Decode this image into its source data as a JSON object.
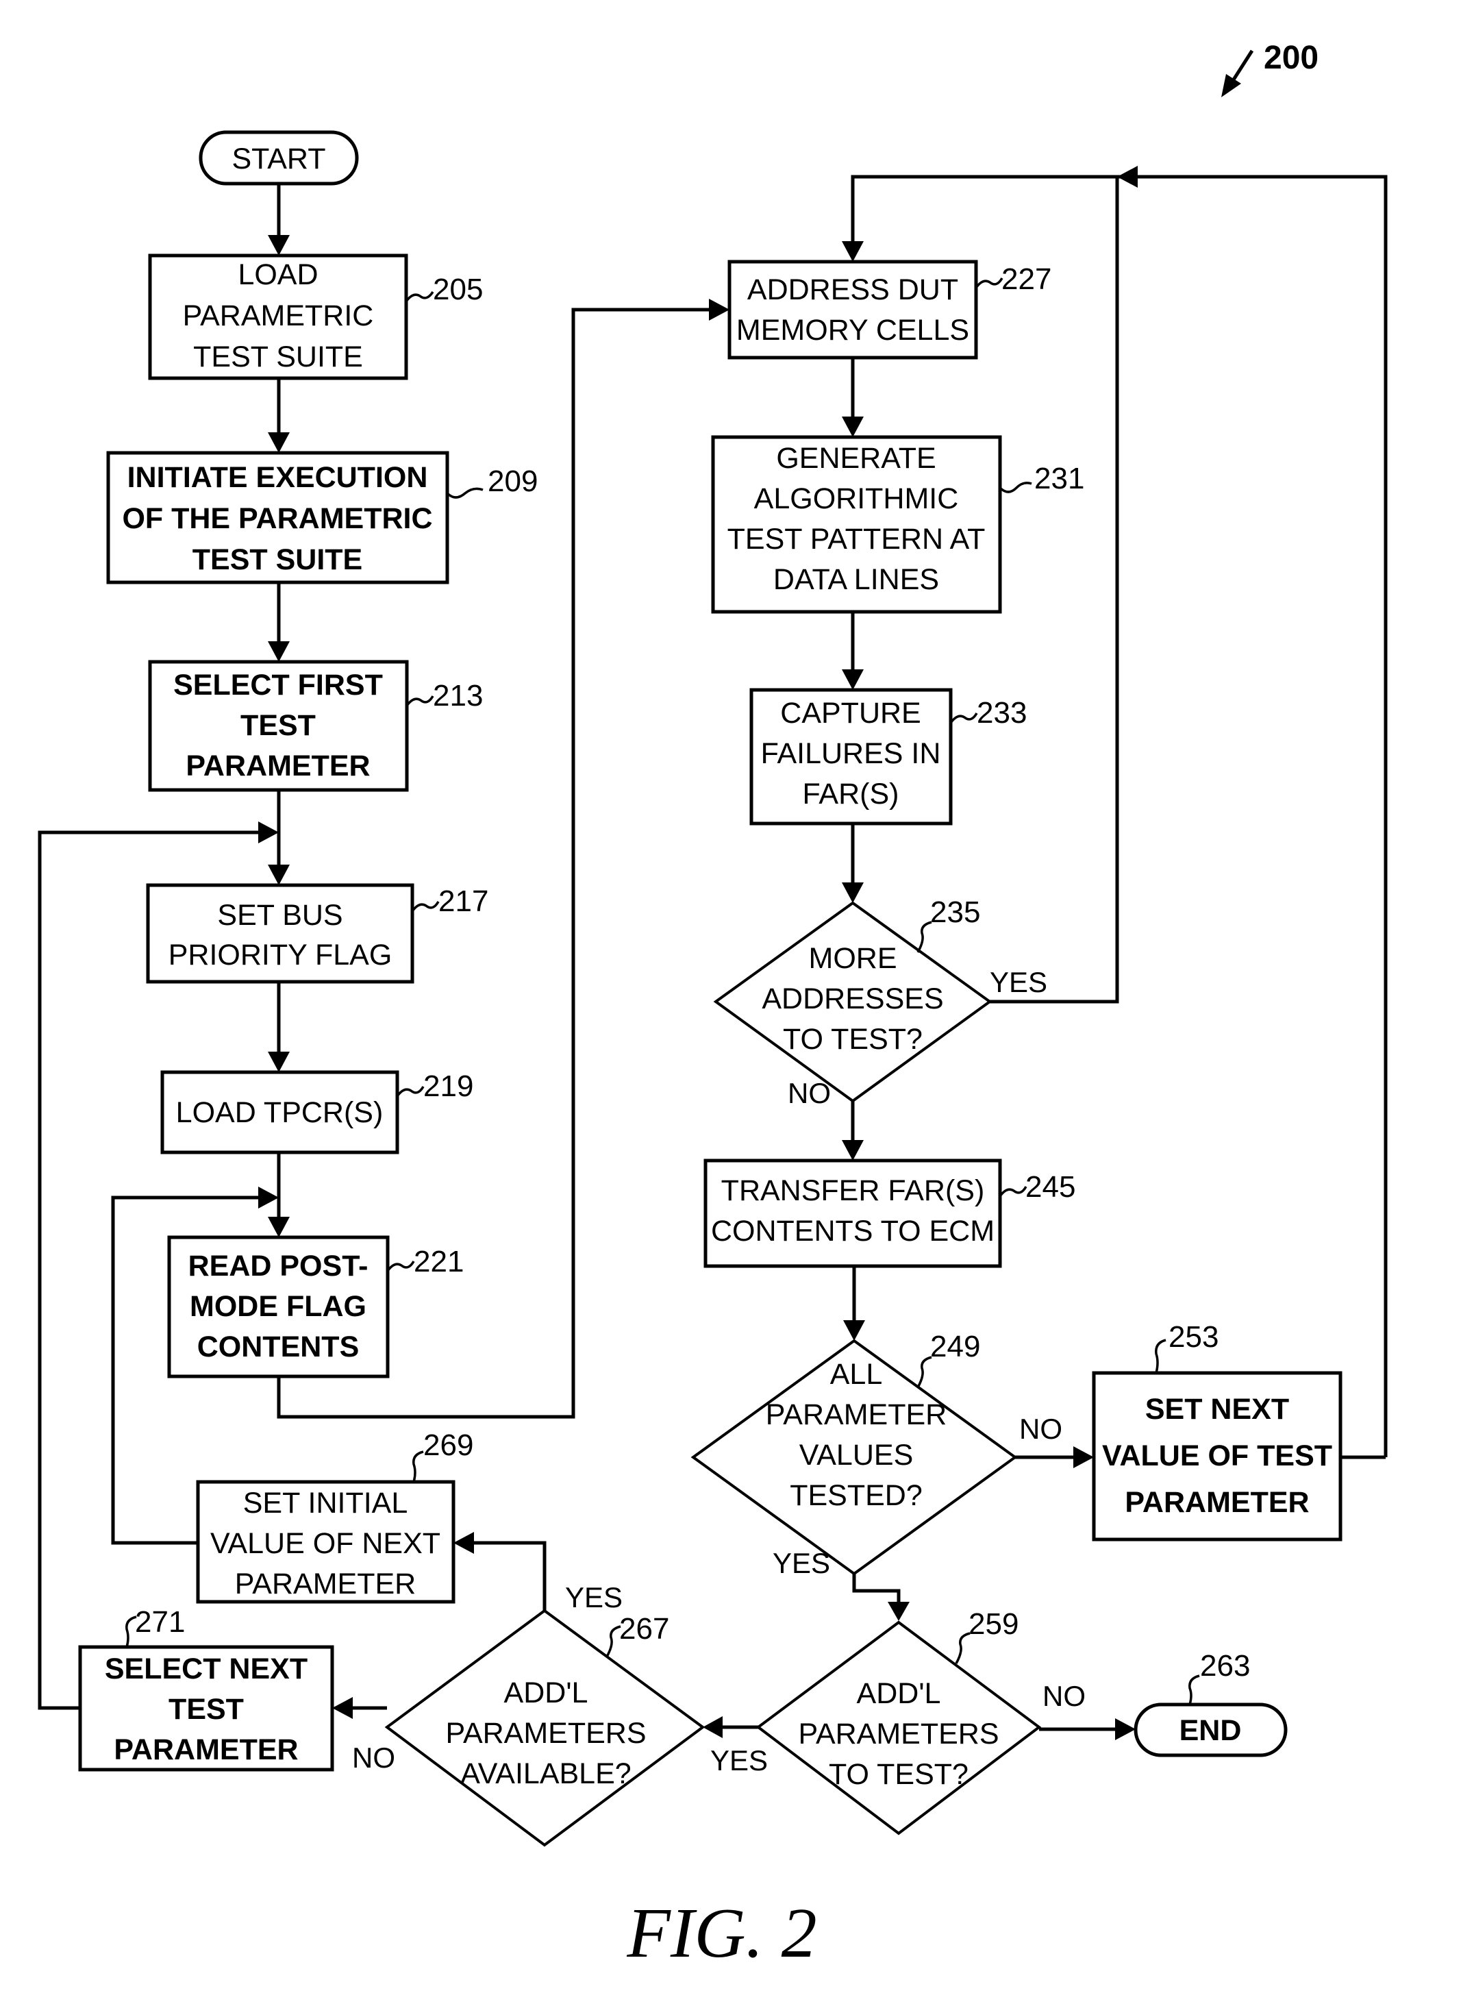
{
  "figure": {
    "caption": "FIG. 2",
    "ref_number": "200"
  },
  "nodes": {
    "start": {
      "type": "terminal",
      "lines": [
        "START"
      ]
    },
    "n205": {
      "ref": "205",
      "type": "process",
      "lines": [
        "LOAD",
        "PARAMETRIC",
        "TEST SUITE"
      ]
    },
    "n209": {
      "ref": "209",
      "type": "process",
      "lines": [
        "INITIATE EXECUTION",
        "OF THE PARAMETRIC",
        "TEST SUITE"
      ]
    },
    "n213": {
      "ref": "213",
      "type": "process",
      "lines": [
        "SELECT FIRST",
        "TEST",
        "PARAMETER"
      ]
    },
    "n217": {
      "ref": "217",
      "type": "process",
      "lines": [
        "SET BUS",
        "PRIORITY FLAG"
      ]
    },
    "n219": {
      "ref": "219",
      "type": "process",
      "lines": [
        "LOAD TPCR(S)"
      ]
    },
    "n221": {
      "ref": "221",
      "type": "process",
      "lines": [
        "READ POST-",
        "MODE FLAG",
        "CONTENTS"
      ]
    },
    "n227": {
      "ref": "227",
      "type": "process",
      "lines": [
        "ADDRESS DUT",
        "MEMORY CELLS"
      ]
    },
    "n231": {
      "ref": "231",
      "type": "process",
      "lines": [
        "GENERATE",
        "ALGORITHMIC",
        "TEST PATTERN AT",
        "DATA LINES"
      ]
    },
    "n233": {
      "ref": "233",
      "type": "process",
      "lines": [
        "CAPTURE",
        "FAILURES IN",
        "FAR(S)"
      ]
    },
    "n235": {
      "ref": "235",
      "type": "decision",
      "lines": [
        "MORE",
        "ADDRESSES",
        "TO TEST?"
      ]
    },
    "n245": {
      "ref": "245",
      "type": "process",
      "lines": [
        "TRANSFER FAR(S)",
        "CONTENTS TO ECM"
      ]
    },
    "n249": {
      "ref": "249",
      "type": "decision",
      "lines": [
        "ALL",
        "PARAMETER",
        "VALUES",
        "TESTED?"
      ]
    },
    "n253": {
      "ref": "253",
      "type": "process",
      "lines": [
        "SET NEXT",
        "VALUE OF TEST",
        "PARAMETER"
      ]
    },
    "n259": {
      "ref": "259",
      "type": "decision",
      "lines": [
        "ADD'L",
        "PARAMETERS",
        "TO TEST?"
      ]
    },
    "n263": {
      "ref": "263",
      "type": "terminal",
      "lines": [
        "END"
      ]
    },
    "n267": {
      "ref": "267",
      "type": "decision",
      "lines": [
        "ADD'L",
        "PARAMETERS",
        "AVAILABLE?"
      ]
    },
    "n269": {
      "ref": "269",
      "type": "process",
      "lines": [
        "SET INITIAL",
        "VALUE OF NEXT",
        "PARAMETER"
      ]
    },
    "n271": {
      "ref": "271",
      "type": "process",
      "lines": [
        "SELECT NEXT",
        "TEST",
        "PARAMETER"
      ]
    }
  },
  "edge_labels": {
    "e235_yes": "YES",
    "e235_no": "NO",
    "e249_no": "NO",
    "e249_yes": "YES",
    "e259_no": "NO",
    "e259_yes": "YES",
    "e267_yes": "YES",
    "e267_no": "NO"
  },
  "edges": [
    {
      "from": "start",
      "to": "n205"
    },
    {
      "from": "n205",
      "to": "n209"
    },
    {
      "from": "n209",
      "to": "n213"
    },
    {
      "from": "n213",
      "to": "n217"
    },
    {
      "from": "n217",
      "to": "n219"
    },
    {
      "from": "n219",
      "to": "n221"
    },
    {
      "from": "n221",
      "to": "n227"
    },
    {
      "from": "n227",
      "to": "n231"
    },
    {
      "from": "n231",
      "to": "n233"
    },
    {
      "from": "n233",
      "to": "n235"
    },
    {
      "from": "n235",
      "to": "n227",
      "label": "YES"
    },
    {
      "from": "n235",
      "to": "n245",
      "label": "NO"
    },
    {
      "from": "n245",
      "to": "n249"
    },
    {
      "from": "n249",
      "to": "n253",
      "label": "NO"
    },
    {
      "from": "n253",
      "to": "n227"
    },
    {
      "from": "n249",
      "to": "n259",
      "label": "YES"
    },
    {
      "from": "n259",
      "to": "n263",
      "label": "NO"
    },
    {
      "from": "n259",
      "to": "n267",
      "label": "YES"
    },
    {
      "from": "n267",
      "to": "n269",
      "label": "YES"
    },
    {
      "from": "n267",
      "to": "n271",
      "label": "NO"
    },
    {
      "from": "n269",
      "to": "n221"
    },
    {
      "from": "n271",
      "to": "n217"
    }
  ]
}
